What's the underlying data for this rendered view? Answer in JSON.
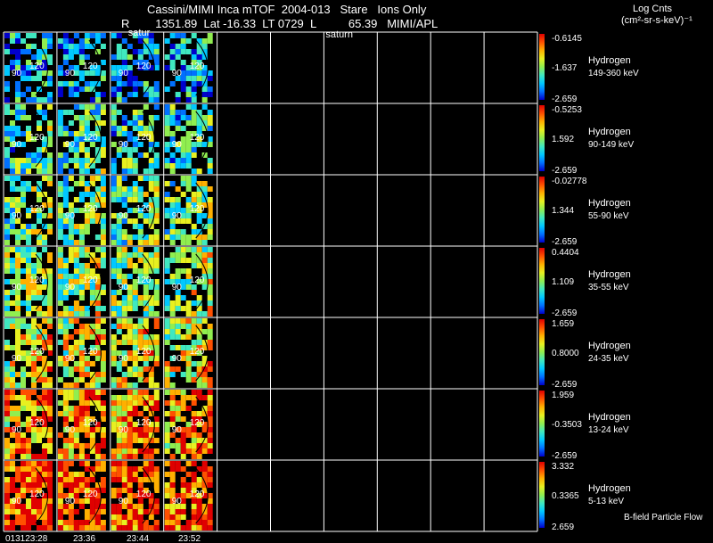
{
  "header": {
    "title": "Cassini/MIMI Inca mTOF  2004-013   Stare   Ions Only",
    "subtitle": "R        1351.89  Lat -16.33  LT 0729  L          65.39   MIMI/APL",
    "units_title": "Log Cnts",
    "units_sub": "(cm²-sr-s-keV)⁻¹"
  },
  "image_labels": [
    "satur",
    "saturn"
  ],
  "footer": {
    "time_labels": [
      "013123:28",
      "23:36",
      "23:44",
      "23:52"
    ],
    "flow_label": "B-field Particle Flow"
  },
  "chart_data": {
    "type": "heatmap",
    "title": "Cassini/MIMI Inca mTOF  2004-013   Stare   Ions Only",
    "x_times": [
      "013123:28",
      "23:36",
      "23:44",
      "23:52"
    ],
    "frames_per_row_total": 10,
    "frames_with_data": 4,
    "contour_labels": [
      "90",
      "120",
      "150"
    ],
    "colormap": [
      "#0000cc",
      "#0070ff",
      "#00c8ff",
      "#40e8c0",
      "#90ee50",
      "#e8f020",
      "#ffb000",
      "#ff5000",
      "#e00000"
    ],
    "panels": [
      {
        "species": "Hydrogen",
        "energy": "149-360 keV",
        "cbar": {
          "max": "-0.6145",
          "mid": "-1.637",
          "min": "-2.659"
        },
        "level": 0.18
      },
      {
        "species": "Hydrogen",
        "energy": "90-149 keV",
        "cbar": {
          "max": "-0.5253",
          "mid": "1.592",
          "min": "-2.659"
        },
        "level": 0.32
      },
      {
        "species": "Hydrogen",
        "energy": "55-90 keV",
        "cbar": {
          "max": "-0.02778",
          "mid": "1.344",
          "min": "-2.659"
        },
        "level": 0.4
      },
      {
        "species": "Hydrogen",
        "energy": "35-55 keV",
        "cbar": {
          "max": "0.4404",
          "mid": "1.109",
          "min": "-2.659"
        },
        "level": 0.45
      },
      {
        "species": "Hydrogen",
        "energy": "24-35 keV",
        "cbar": {
          "max": "1.659",
          "mid": "0.8000",
          "min": "-2.659"
        },
        "level": 0.55
      },
      {
        "species": "Hydrogen",
        "energy": "13-24 keV",
        "cbar": {
          "max": "1.959",
          "mid": "-0.3503",
          "min": "-2.659"
        },
        "level": 0.68
      },
      {
        "species": "Hydrogen",
        "energy": "5-13 keV",
        "cbar": {
          "max": "3.332",
          "mid": "0.3365",
          "min": "2.659"
        },
        "level": 0.8
      }
    ]
  }
}
